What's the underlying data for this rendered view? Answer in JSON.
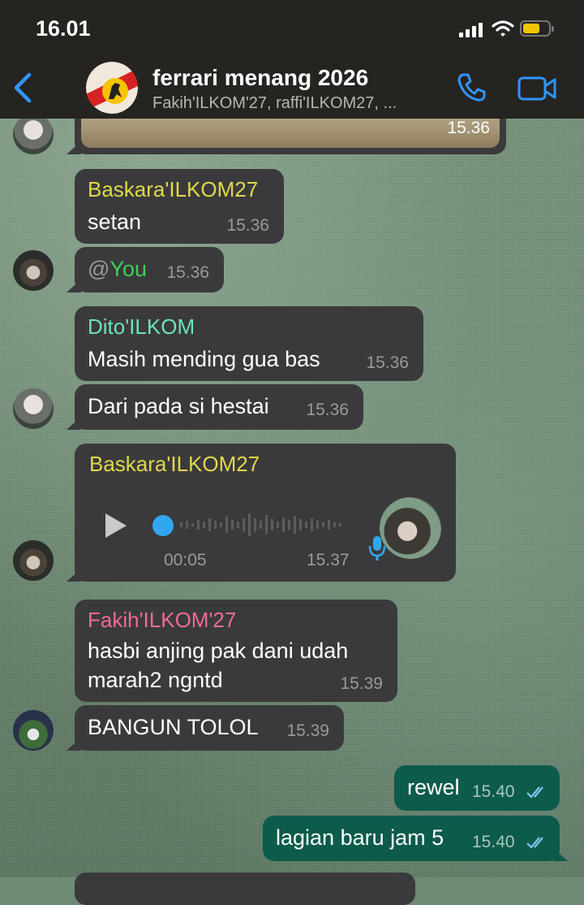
{
  "status_bar": {
    "time": "16.01"
  },
  "header": {
    "group_name": "ferrari menang 2026",
    "members": "Fakih'ILKOM'27, raffi'ILKOM27, ..."
  },
  "colors": {
    "accent_blue": "#2f95ff",
    "incoming_bubble": "#3a3a3c",
    "outgoing_bubble": "#0d5b4b",
    "name_baskara": "#e0d84a",
    "name_dito": "#6fe3b8",
    "name_fakih": "#f06a9a",
    "mention": "#3fcf5a"
  },
  "messages": [
    {
      "id": "m0",
      "time": "15.36"
    },
    {
      "id": "m1",
      "sender": "Baskara'ILKOM27",
      "text": "setan",
      "time": "15.36"
    },
    {
      "id": "m2",
      "mention_prefix": "@",
      "mention": "You",
      "time": "15.36"
    },
    {
      "id": "m3",
      "sender": "Dito'ILKOM",
      "text": "Masih mending gua bas",
      "time": "15.36"
    },
    {
      "id": "m4",
      "text": "Dari pada si hestai",
      "time": "15.36"
    },
    {
      "id": "m5",
      "sender": "Baskara'ILKOM27",
      "duration": "00:05",
      "time": "15.37",
      "played": 0.0
    },
    {
      "id": "m6",
      "sender": "Fakih'ILKOM'27",
      "text_line1": "hasbi anjing pak dani udah",
      "text_line2": "marah2 ngntd",
      "time": "15.39"
    },
    {
      "id": "m7",
      "text": "BANGUN TOLOL",
      "time": "15.39"
    },
    {
      "id": "m8",
      "text": "rewel",
      "time": "15.40",
      "status": "read"
    },
    {
      "id": "m9",
      "text": "lagian baru jam 5",
      "time": "15.40",
      "status": "read"
    }
  ]
}
